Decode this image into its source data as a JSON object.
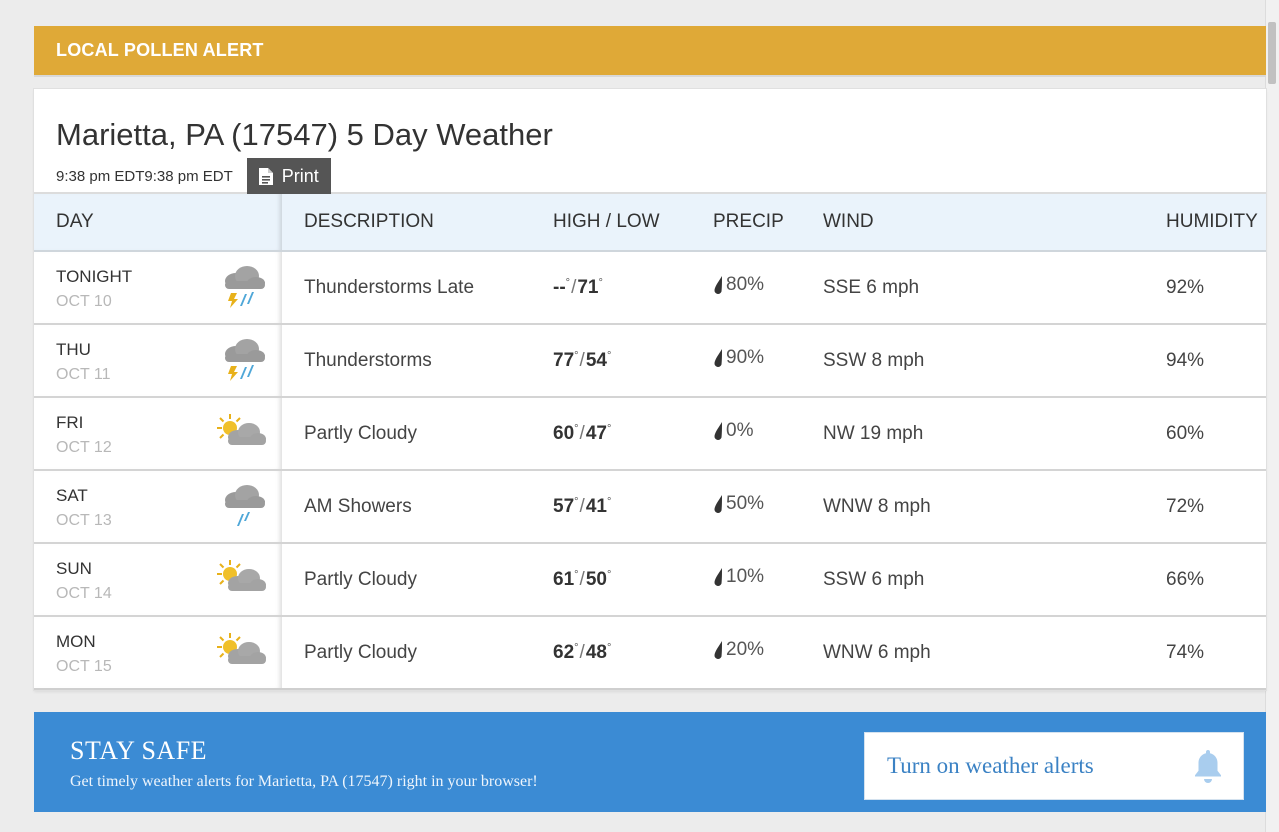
{
  "pollen_bar": {
    "label": "LOCAL POLLEN ALERT"
  },
  "header": {
    "title": "Marietta, PA (17547) 5 Day Weather",
    "time": "9:38 pm EDT9:38 pm EDT",
    "print_label": "Print"
  },
  "table": {
    "columns": {
      "day": "DAY",
      "description": "DESCRIPTION",
      "high_low": "HIGH / LOW",
      "precip": "PRECIP",
      "wind": "WIND",
      "humidity": "HUMIDITY"
    },
    "rows": [
      {
        "day": "TONIGHT",
        "date": "OCT 10",
        "icon": "thunderstorm-icon",
        "description": "Thunderstorms Late",
        "high": "--",
        "low": "71",
        "precip": "80%",
        "wind": "SSE 6 mph",
        "humidity": "92%"
      },
      {
        "day": "THU",
        "date": "OCT 11",
        "icon": "thunderstorm-icon",
        "description": "Thunderstorms",
        "high": "77",
        "low": "54",
        "precip": "90%",
        "wind": "SSW 8 mph",
        "humidity": "94%"
      },
      {
        "day": "FRI",
        "date": "OCT 12",
        "icon": "partly-cloudy-icon",
        "description": "Partly Cloudy",
        "high": "60",
        "low": "47",
        "precip": "0%",
        "wind": "NW 19 mph",
        "humidity": "60%"
      },
      {
        "day": "SAT",
        "date": "OCT 13",
        "icon": "showers-icon",
        "description": "AM Showers",
        "high": "57",
        "low": "41",
        "precip": "50%",
        "wind": "WNW 8 mph",
        "humidity": "72%"
      },
      {
        "day": "SUN",
        "date": "OCT 14",
        "icon": "partly-cloudy-icon",
        "description": "Partly Cloudy",
        "high": "61",
        "low": "50",
        "precip": "10%",
        "wind": "SSW 6 mph",
        "humidity": "66%"
      },
      {
        "day": "MON",
        "date": "OCT 15",
        "icon": "partly-cloudy-icon",
        "description": "Partly Cloudy",
        "high": "62",
        "low": "48",
        "precip": "20%",
        "wind": "WNW 6 mph",
        "humidity": "74%"
      }
    ]
  },
  "stay_safe": {
    "title": "STAY SAFE",
    "subtitle": "Get timely weather alerts for Marietta, PA (17547) right in your browser!",
    "button_label": "Turn on weather alerts"
  },
  "colors": {
    "pollen_bar": "#dfa937",
    "stay_safe_bg": "#3b8bd4",
    "table_header_bg": "#eaf3fb",
    "print_button_bg": "#555555"
  }
}
